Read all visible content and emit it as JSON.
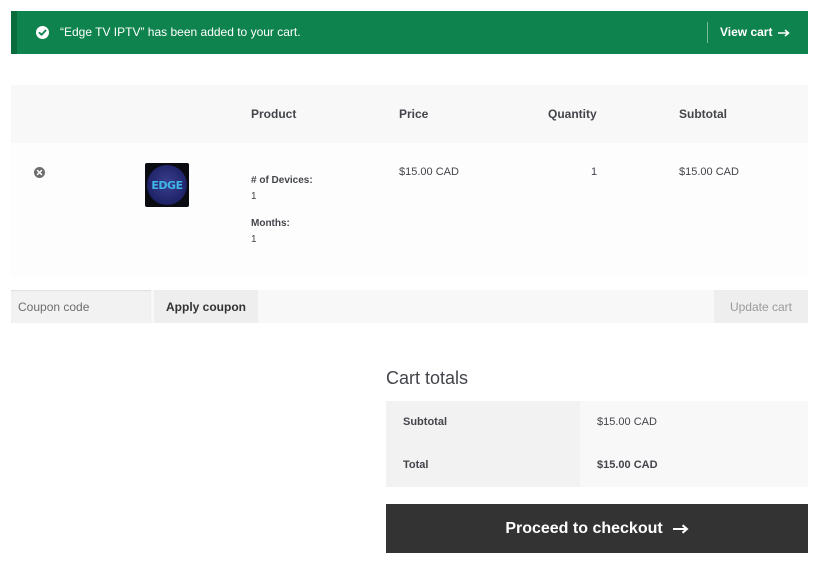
{
  "notice": {
    "message": "“Edge TV IPTV” has been added to your cart.",
    "link_label": "View cart",
    "icon": "check-circle-icon",
    "bg_color": "#0f834d"
  },
  "table": {
    "headers": {
      "product": "Product",
      "price": "Price",
      "quantity": "Quantity",
      "subtotal": "Subtotal"
    },
    "row": {
      "remove_icon": "remove-circle-icon",
      "thumbnail_text": "EDGE",
      "meta": [
        {
          "label": "# of Devices:",
          "value": "1"
        },
        {
          "label": "Months:",
          "value": "1"
        }
      ],
      "price": "$15.00 CAD",
      "quantity": "1",
      "subtotal": "$15.00 CAD"
    }
  },
  "actions": {
    "coupon_placeholder": "Coupon code",
    "apply_label": "Apply coupon",
    "update_label": "Update cart"
  },
  "totals": {
    "title": "Cart totals",
    "subtotal_label": "Subtotal",
    "subtotal_value": "$15.00 CAD",
    "total_label": "Total",
    "total_value": "$15.00 CAD"
  },
  "checkout": {
    "label": "Proceed to checkout",
    "icon": "arrow-right-icon",
    "bg_color": "#333333"
  }
}
